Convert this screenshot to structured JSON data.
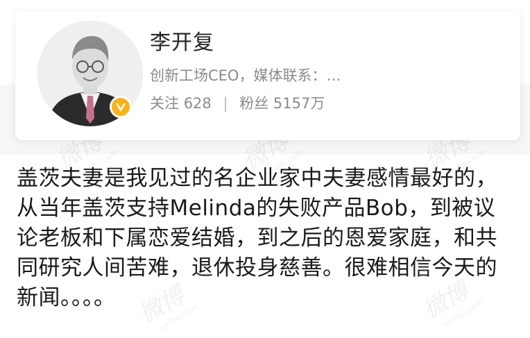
{
  "profile": {
    "name": "李开复",
    "bio": "创新工场CEO，媒体联系：…",
    "following_label": "关注",
    "following_count": "628",
    "followers_label": "粉丝",
    "followers_count": "5157万",
    "verified_icon": "verified-badge-icon",
    "accent_color": "#f7b21c"
  },
  "post": {
    "lines": [
      "盖茨夫妻是我见过的名企业家中夫妻感情最好的，",
      "从当年盖茨支持Melinda的失败产品Bob，到被议",
      "论老板和下属恋爱结婚，到之后的恩爱家庭，和共",
      "同研究人间苦难，退休投身慈善。很难相信今天的",
      "新闻。。。。"
    ]
  },
  "watermarks": [
    {
      "main": "微博",
      "sub": "weibo.com"
    },
    {
      "main": "微博",
      "sub": "weibo.com"
    },
    {
      "main": "微博",
      "sub": "weibo.com"
    },
    {
      "main": "微博",
      "sub": "weibo.com"
    },
    {
      "main": "微博",
      "sub": "weibo.com"
    }
  ]
}
